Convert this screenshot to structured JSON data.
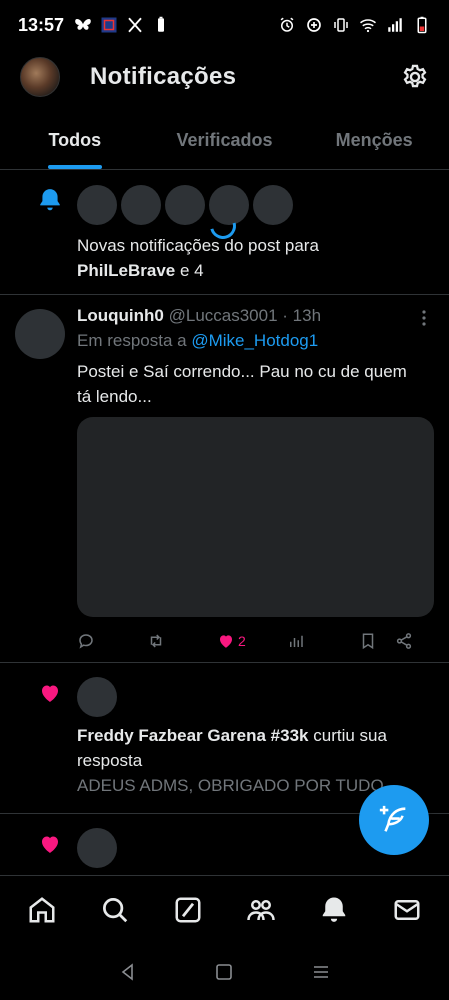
{
  "status_bar": {
    "time": "13:57",
    "left_icons": [
      "butterfly-icon",
      "app-icon",
      "x-logo-icon",
      "battery-small-icon"
    ],
    "right_icons": [
      "alarm-icon",
      "data-saver-icon",
      "vibrate-icon",
      "wifi-icon",
      "signal-icon",
      "battery-icon"
    ]
  },
  "header": {
    "title": "Notificações"
  },
  "tabs": [
    {
      "label": "Todos",
      "active": true
    },
    {
      "label": "Verificados",
      "active": false
    },
    {
      "label": "Menções",
      "active": false
    }
  ],
  "notifications": {
    "new_posts": {
      "text_prefix": "Novas notificações do post para ",
      "user": "PhilLeBrave",
      "suffix": " e 4"
    },
    "tweet": {
      "name": "Louquinh0",
      "handle": "@Luccas3001",
      "time": "· 13h",
      "reply_prefix": "Em resposta a ",
      "reply_to": "@Mike_Hotdog1",
      "text": "Postei e Saí correndo... Pau no cu de quem tá lendo...",
      "like_count": "2"
    },
    "like1": {
      "user": "Freddy Fazbear Garena #33k",
      "action": " curtiu sua resposta",
      "snippet": "ADEUS ADMS, OBRIGADO POR TUDO"
    }
  },
  "colors": {
    "accent": "#1d9bf0",
    "like": "#f91880",
    "background": "#000000",
    "secondary_text": "#71767b"
  }
}
